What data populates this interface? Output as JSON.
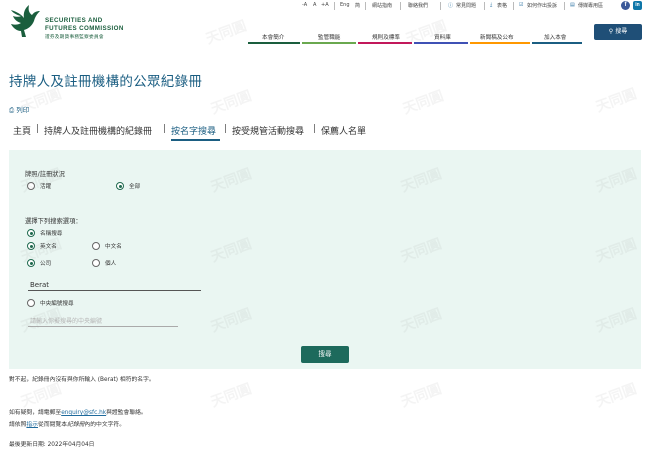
{
  "header": {
    "logo_en_line1": "SECURITIES AND",
    "logo_en_line2": "FUTURES COMMISSION",
    "logo_zh": "證券及期貨事務監察委員會",
    "font_small": "-A",
    "font_mid": "A",
    "font_large": "+A",
    "lang_en": "Eng",
    "lang_sc": "简",
    "site_map": "網站指南",
    "contact": "聯絡我們",
    "faq": "常見問題",
    "downloads": "表格",
    "complaint": "如何作出投訴",
    "media": "傳媒專用區",
    "search_label": "搜尋",
    "nav": [
      "本會簡介",
      "監管職能",
      "規則及標準",
      "資料庫",
      "新聞稿及公布",
      "加入本會"
    ]
  },
  "page": {
    "title": "持牌人及註冊機構的公眾紀錄冊",
    "print_label": "列印",
    "tabs": [
      "主頁",
      "持牌人及註冊機構的紀錄冊",
      "按名字搜尋",
      "按受規管活動搜尋",
      "保薦人名單"
    ],
    "tab_sep": "|"
  },
  "form": {
    "status_label": "牌照/註冊狀況",
    "status_active": "活躍",
    "status_all": "全部",
    "criteria_label": "選擇下列搜索選項：",
    "name_search": "名稱搜尋",
    "english_name": "英文名",
    "chinese_name": "中文名",
    "corporation": "公司",
    "individual": "個人",
    "name_value": "Berat",
    "ce_search": "中央編號搜尋",
    "ce_placeholder": "請輸入你擬搜尋的中央編號",
    "submit_label": "搜尋"
  },
  "footer": {
    "no_result": "對不起，紀錄冊內沒有與你所輸入 (Berat) 相符的名字。",
    "enquiry_prefix": "如有疑問，請電郵至",
    "email": "enquiry@sfc.hk",
    "enquiry_suffix": "與證監會聯絡。",
    "help_prefix": "請依照",
    "help_link": "指示",
    "help_mid": "從而閱覽本",
    "help_italic": "紀錄冊",
    "help_suffix": "內的中文字符。",
    "last_updated": "最後更新日期: 2022年04月04日"
  },
  "watermark": "天同圓",
  "colors": {
    "brand_green": "#1a5e3d",
    "brand_blue": "#1b5e82",
    "panel_bg": "#eaf6f2",
    "submit_bg": "#1d6a5c",
    "search_bg": "#1f4f77"
  }
}
